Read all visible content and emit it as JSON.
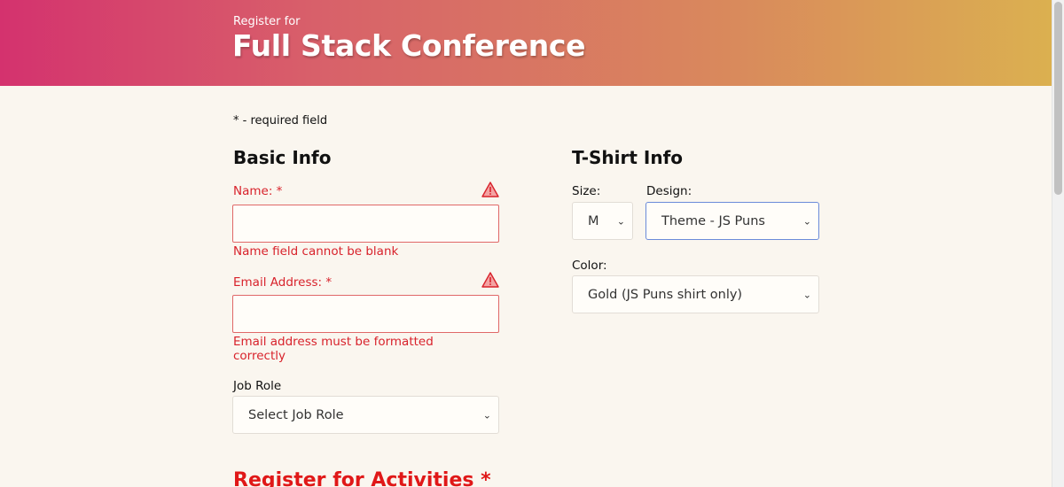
{
  "header": {
    "subtitle": "Register for",
    "title": "Full Stack Conference"
  },
  "required_note": "* - required field",
  "basic_info": {
    "heading": "Basic Info",
    "name": {
      "label": "Name: *",
      "error": "Name field cannot be blank",
      "value": ""
    },
    "email": {
      "label": "Email Address: *",
      "error_line1": "Email address must be formatted",
      "error_line2": "correctly",
      "value": ""
    },
    "job_role": {
      "label": "Job Role",
      "selected": "Select Job Role"
    }
  },
  "tshirt_info": {
    "heading": "T-Shirt Info",
    "size": {
      "label": "Size:",
      "selected": "M"
    },
    "design": {
      "label": "Design:",
      "selected": "Theme - JS Puns"
    },
    "color": {
      "label": "Color:",
      "selected": "Gold (JS Puns shirt only)"
    }
  },
  "activities": {
    "heading": "Register for Activities *"
  },
  "colors": {
    "error": "#d8222b",
    "background": "#faf6ef",
    "focus": "#6b8bd9"
  },
  "icons": {
    "warning": "warning-triangle-icon",
    "chevron": "chevron-down-icon"
  }
}
